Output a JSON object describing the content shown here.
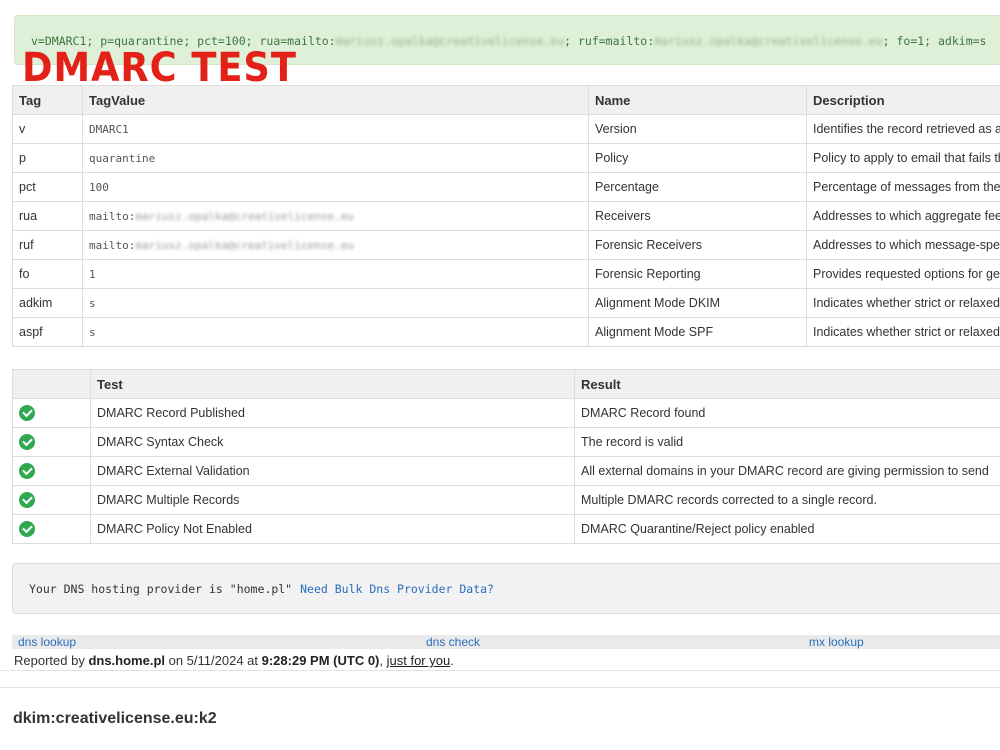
{
  "record": {
    "prefix": "v=DMARC1; p=quarantine; pct=100; rua=mailto:",
    "rua_hidden": "mariusz.opalka@creativelicense.eu",
    "middle": "; ruf=mailto:",
    "ruf_hidden": "mariusz.opalka@creativelicense.eu",
    "suffix": "; fo=1; adkim=s"
  },
  "stamp": "DMARC TEST",
  "tag_table": {
    "headers": [
      "Tag",
      "TagValue",
      "Name",
      "Description"
    ],
    "rows": [
      {
        "tag": "v",
        "value": "DMARC1",
        "name": "Version",
        "desc": "Identifies the record retrieved as a"
      },
      {
        "tag": "p",
        "value": "quarantine",
        "name": "Policy",
        "desc": "Policy to apply to email that fails th"
      },
      {
        "tag": "pct",
        "value": "100",
        "name": "Percentage",
        "desc": "Percentage of messages from the"
      },
      {
        "tag": "rua",
        "value_prefix": "mailto:",
        "value_hidden": "mariusz.opalka@creativelicense.eu",
        "name": "Receivers",
        "desc": "Addresses to which aggregate fee"
      },
      {
        "tag": "ruf",
        "value_prefix": "mailto:",
        "value_hidden": "mariusz.opalka@creativelicense.eu",
        "name": "Forensic Receivers",
        "desc": "Addresses to which message-spe"
      },
      {
        "tag": "fo",
        "value": "1",
        "name": "Forensic Reporting",
        "desc": "Provides requested options for ge"
      },
      {
        "tag": "adkim",
        "value": "s",
        "name": "Alignment Mode DKIM",
        "desc": "Indicates whether strict or relaxed"
      },
      {
        "tag": "aspf",
        "value": "s",
        "name": "Alignment Mode SPF",
        "desc": "Indicates whether strict or relaxed"
      }
    ]
  },
  "test_table": {
    "headers": [
      "",
      "Test",
      "Result"
    ],
    "rows": [
      {
        "status": "check-icon",
        "test": "DMARC Record Published",
        "result": "DMARC Record found"
      },
      {
        "status": "check-icon",
        "test": "DMARC Syntax Check",
        "result": "The record is valid"
      },
      {
        "status": "check-icon",
        "test": "DMARC External Validation",
        "result": "All external domains in your DMARC record are giving permission to send"
      },
      {
        "status": "check-icon",
        "test": "DMARC Multiple Records",
        "result": "Multiple DMARC records corrected to a single record."
      },
      {
        "status": "check-icon",
        "test": "DMARC Policy Not Enabled",
        "result": "DMARC Quarantine/Reject policy enabled"
      }
    ]
  },
  "dns_provider": {
    "text": "Your DNS hosting provider is \"home.pl\"",
    "link": "Need Bulk Dns Provider Data?"
  },
  "links": [
    "dns lookup",
    "dns check",
    "mx lookup"
  ],
  "reported": {
    "prefix": "Reported by ",
    "host": "dns.home.pl",
    "date_text": " on 5/11/2024 at ",
    "time": "9:28:29 PM (UTC 0)",
    "comma": ", ",
    "link": "just for you",
    "end": "."
  },
  "dkim_title": "dkim:creativelicense.eu:k2",
  "colors": {
    "success": "#2fa84f",
    "stamp": "#e32119",
    "record_bg": "#dff0d8",
    "link": "#2a6ebb"
  }
}
